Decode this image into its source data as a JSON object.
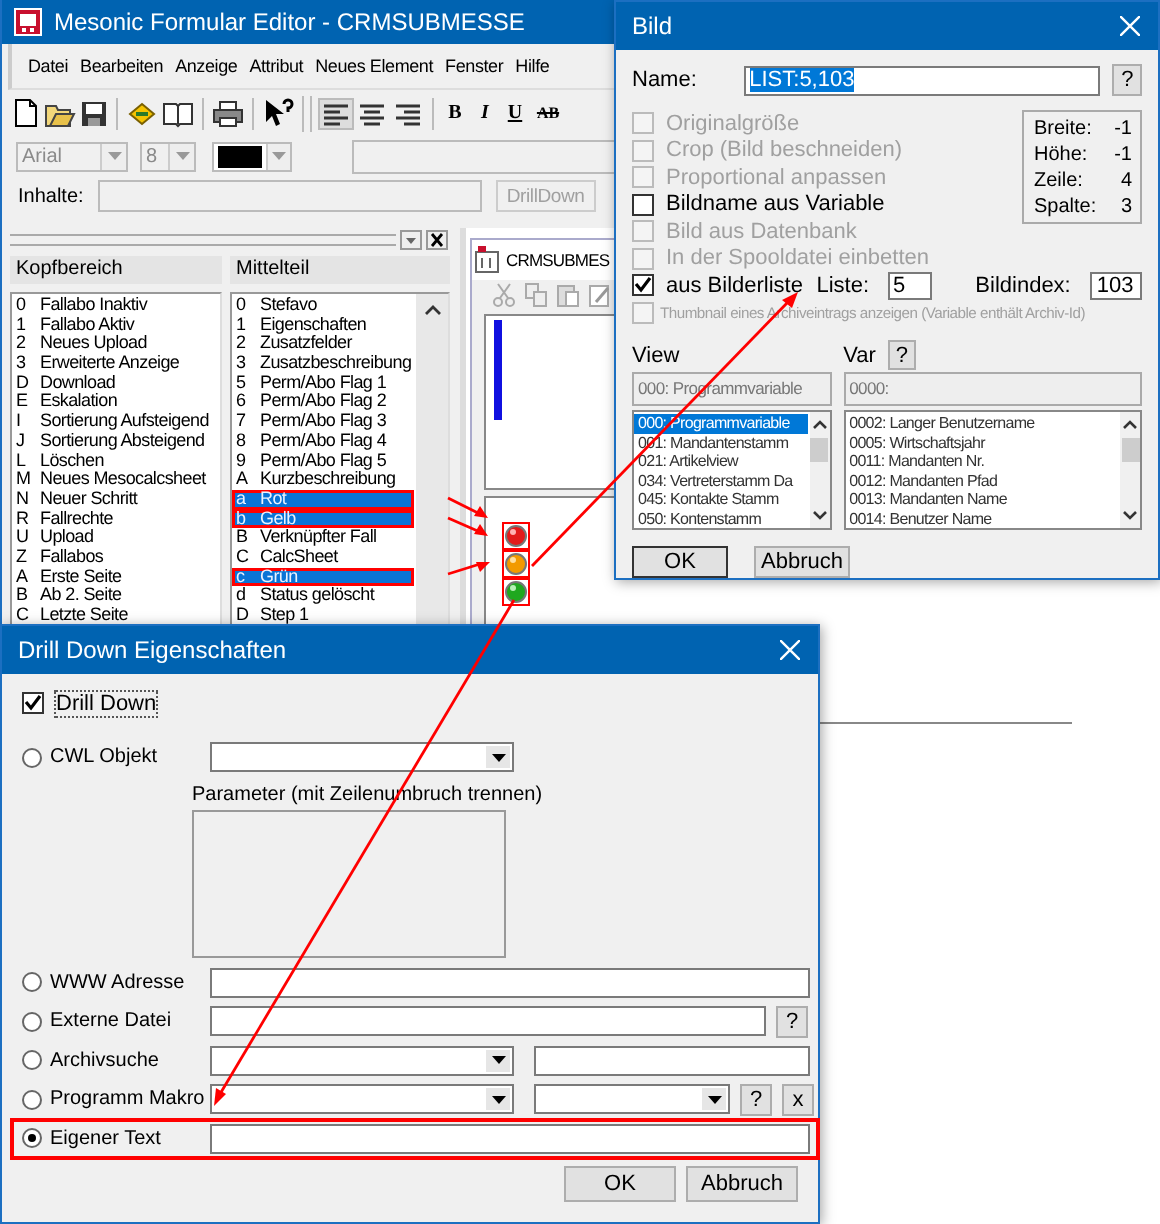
{
  "main_window": {
    "title": "Mesonic Formular Editor - CRMSUBMESSE",
    "menu": [
      "Datei",
      "Bearbeiten",
      "Anzeige",
      "Attribut",
      "Neues Element",
      "Fenster",
      "Hilfe"
    ],
    "format_buttons": [
      {
        "kind": "bold",
        "label": "B"
      },
      {
        "kind": "italic",
        "label": "I"
      },
      {
        "kind": "underline",
        "label": "U"
      },
      {
        "kind": "strike",
        "label": "AB"
      }
    ],
    "font_field": {
      "value": "Arial",
      "disabled": true
    },
    "size_field": {
      "value": "8",
      "disabled": true
    },
    "inhalte_label": "Inhalte:",
    "drilldown_button": {
      "label": "DrillDown",
      "disabled": true
    },
    "panel": {
      "columns": [
        {
          "header": "Kopfbereich",
          "items": [
            {
              "key": "0",
              "label": "Fallabo Inaktiv",
              "selected": false
            },
            {
              "key": "1",
              "label": "Fallabo Aktiv",
              "selected": false
            },
            {
              "key": "2",
              "label": "Neues Upload",
              "selected": false
            },
            {
              "key": "3",
              "label": "Erweiterte Anzeige",
              "selected": false
            },
            {
              "key": "D",
              "label": "Download",
              "selected": false
            },
            {
              "key": "E",
              "label": "Eskalation",
              "selected": false
            },
            {
              "key": "I",
              "label": "Sortierung Aufsteigend",
              "selected": false
            },
            {
              "key": "J",
              "label": "Sortierung Absteigend",
              "selected": false
            },
            {
              "key": "L",
              "label": "Löschen",
              "selected": false
            },
            {
              "key": "M",
              "label": "Neues Mesocalcsheet",
              "selected": false
            },
            {
              "key": "N",
              "label": "Neuer Schritt",
              "selected": false
            },
            {
              "key": "R",
              "label": "Fallrechte",
              "selected": false
            },
            {
              "key": "U",
              "label": "Upload",
              "selected": false
            },
            {
              "key": "Z",
              "label": "Fallabos",
              "selected": false
            },
            {
              "key": "A",
              "label": "Erste Seite",
              "selected": false
            },
            {
              "key": "B",
              "label": "Ab 2. Seite",
              "selected": false
            },
            {
              "key": "C",
              "label": "Letzte Seite",
              "selected": false
            }
          ]
        },
        {
          "header": "Mittelteil",
          "items": [
            {
              "key": "0",
              "label": "Stefavo",
              "selected": false
            },
            {
              "key": "1",
              "label": "Eigenschaften",
              "selected": false
            },
            {
              "key": "2",
              "label": "Zusatzfelder",
              "selected": false
            },
            {
              "key": "3",
              "label": "Zusatzbeschreibung",
              "selected": false
            },
            {
              "key": "5",
              "label": "Perm/Abo Flag 1",
              "selected": false
            },
            {
              "key": "6",
              "label": "Perm/Abo Flag 2",
              "selected": false
            },
            {
              "key": "7",
              "label": "Perm/Abo Flag 3",
              "selected": false
            },
            {
              "key": "8",
              "label": "Perm/Abo Flag 4",
              "selected": false
            },
            {
              "key": "9",
              "label": "Perm/Abo Flag 5",
              "selected": false
            },
            {
              "key": "A",
              "label": "Kurzbeschreibung",
              "selected": false
            },
            {
              "key": "a",
              "label": "Rot",
              "selected": true
            },
            {
              "key": "b",
              "label": "Gelb",
              "selected": true
            },
            {
              "key": "B",
              "label": "Verknüpfter Fall",
              "selected": false
            },
            {
              "key": "C",
              "label": "CalcSheet",
              "selected": false
            },
            {
              "key": "c",
              "label": "Grün",
              "selected": true
            },
            {
              "key": "d",
              "label": "Status gelöscht",
              "selected": false
            },
            {
              "key": "D",
              "label": "Step 1",
              "selected": false
            }
          ]
        }
      ]
    },
    "child_window": {
      "title": "CRMSUBMES"
    }
  },
  "bild_dialog": {
    "title": "Bild",
    "name_label": "Name:",
    "name_value": "LIST:5,103",
    "help_button": "?",
    "options": [
      {
        "label": "Originalgröße",
        "checked": false,
        "disabled": true
      },
      {
        "label": "Crop (Bild beschneiden)",
        "checked": false,
        "disabled": true
      },
      {
        "label": "Proportional anpassen",
        "checked": false,
        "disabled": true
      },
      {
        "label": "Bildname aus Variable",
        "checked": false,
        "disabled": false
      },
      {
        "label": "Bild aus Datenbank",
        "checked": false,
        "disabled": true
      },
      {
        "label": "In der Spooldatei einbetten",
        "checked": false,
        "disabled": true
      }
    ],
    "info": [
      {
        "label": "Breite:",
        "value": "-1"
      },
      {
        "label": "Höhe:",
        "value": "-1"
      },
      {
        "label": "Zeile:",
        "value": "4"
      },
      {
        "label": "Spalte:",
        "value": "3"
      }
    ],
    "bilderliste": {
      "label": "aus Bilderliste",
      "checked": true,
      "disabled": false,
      "liste_label": "Liste:",
      "liste_value": "5",
      "bildindex_label": "Bildindex:",
      "bildindex_value": "103"
    },
    "thumbnail": {
      "label": "Thumbnail eines Archiveintrags anzeigen (Variable enthält Archiv-Id)",
      "checked": false,
      "disabled": true
    },
    "view_label": "View",
    "view_field": "000: Programmvariable",
    "view_items": [
      {
        "label": "000: Programmvariable",
        "selected": true
      },
      {
        "label": "001: Mandantenstamm",
        "selected": false
      },
      {
        "label": "021: Artikelview",
        "selected": false
      },
      {
        "label": "034: Vertreterstamm Da",
        "selected": false
      },
      {
        "label": "045: Kontakte Stamm",
        "selected": false
      },
      {
        "label": "050: Kontenstamm",
        "selected": false
      }
    ],
    "var_label": "Var",
    "var_help": "?",
    "var_field": "0000:",
    "var_items": [
      {
        "label": "0002: Langer Benutzername",
        "selected": false
      },
      {
        "label": "0005: Wirtschaftsjahr",
        "selected": false
      },
      {
        "label": "0011: Mandanten Nr.",
        "selected": false
      },
      {
        "label": "0012: Mandanten Pfad",
        "selected": false
      },
      {
        "label": "0013: Mandanten Name",
        "selected": false
      },
      {
        "label": "0014: Benutzer Name",
        "selected": false
      }
    ],
    "ok": "OK",
    "cancel": "Abbruch"
  },
  "drill_dialog": {
    "title": "Drill Down Eigenschaften",
    "drill_down": {
      "label": "Drill Down",
      "checked": true
    },
    "options": [
      {
        "kind": "combo_params",
        "label": "CWL Objekt",
        "selected": false,
        "parameter_label": "Parameter (mit Zeilenumbruch trennen)"
      },
      {
        "kind": "text",
        "label": "WWW Adresse",
        "selected": false
      },
      {
        "kind": "file",
        "label": "Externe Datei",
        "selected": false,
        "help_button": "?"
      },
      {
        "kind": "combo_text",
        "label": "Archivsuche",
        "selected": false
      },
      {
        "kind": "macro",
        "label": "Programm Makro",
        "selected": false,
        "help_button": "?",
        "clear_button": "x"
      },
      {
        "kind": "text",
        "label": "Eigener Text",
        "selected": true
      }
    ],
    "ok": "OK",
    "cancel": "Abbruch"
  }
}
